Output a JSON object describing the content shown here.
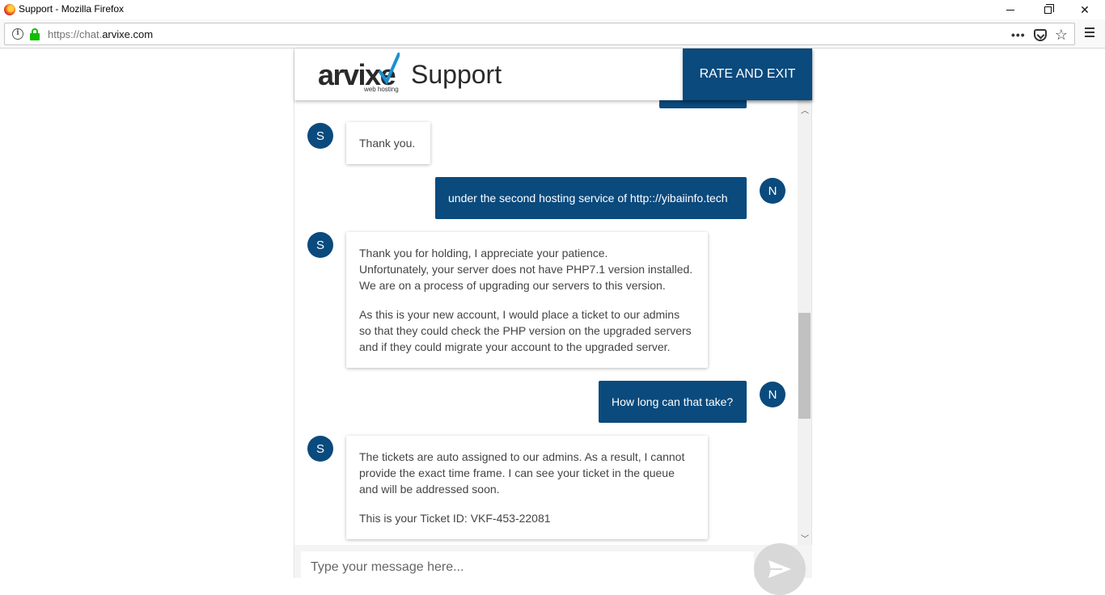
{
  "window": {
    "title": "Support - Mozilla Firefox"
  },
  "browser": {
    "url_prefix": "https://chat.",
    "url_host": "arvixe.com",
    "page_actions_icon": "more-dots-icon"
  },
  "header": {
    "logo_word": "arvixe",
    "logo_sub": "web hosting",
    "support_label": "Support",
    "rate_button": "RATE AND EXIT"
  },
  "messages": [
    {
      "sender": "S",
      "side": "in",
      "paragraphs": [
        "Thank you."
      ]
    },
    {
      "sender": "N",
      "side": "out",
      "text": "under the second hosting service of http:://yibaiinfo.tech"
    },
    {
      "sender": "S",
      "side": "in",
      "paragraphs": [
        "Thank you for holding, I appreciate your patience.\nUnfortunately, your server does not have PHP7.1 version installed.\nWe are on a process of upgrading our servers to this version.",
        "As this is your new account, I would place a ticket to our admins\nso that they could check the PHP version on the upgraded servers\nand if they could migrate your account to the upgraded server."
      ]
    },
    {
      "sender": "N",
      "side": "out",
      "text": "How long can that take?"
    },
    {
      "sender": "S",
      "side": "in",
      "paragraphs": [
        "The tickets are auto assigned to our admins. As a result, I cannot\nprovide the exact time frame. I can see your ticket in the queue\nand will be addressed soon.",
        "This is your Ticket ID: VKF-453-22081"
      ]
    }
  ],
  "composer": {
    "placeholder": "Type your message here..."
  },
  "colors": {
    "brand": "#0a4a7d",
    "logo_check": "#1a8fd0"
  }
}
